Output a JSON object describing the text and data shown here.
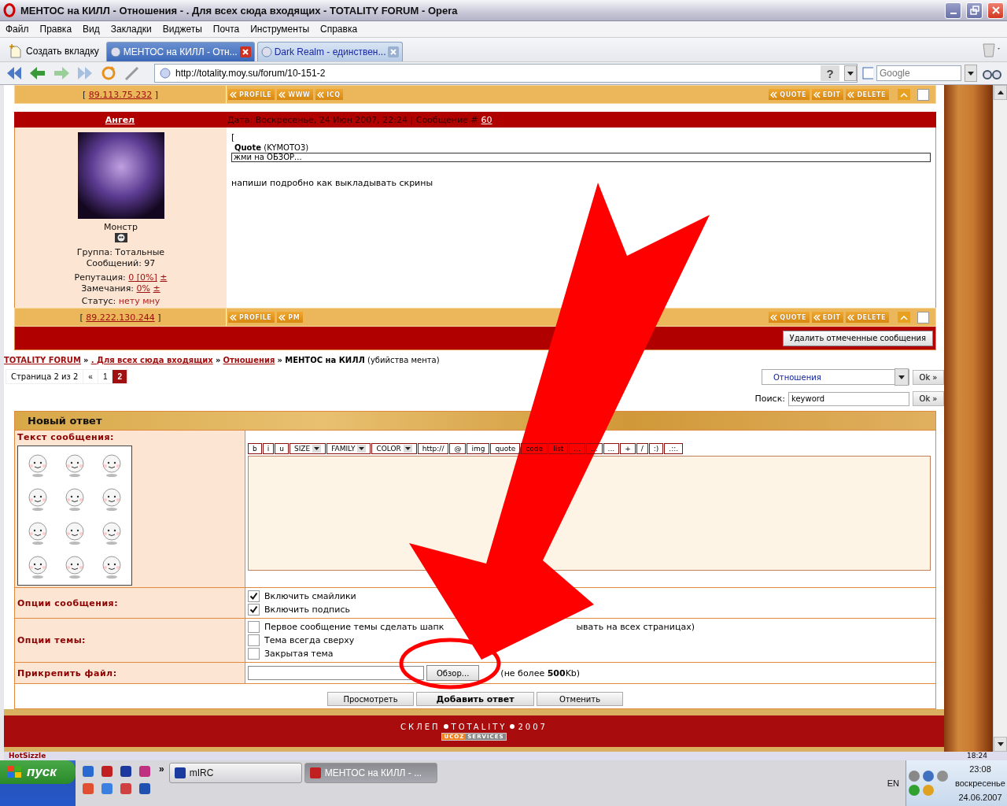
{
  "window": {
    "title": "МЕНТОС на КИЛЛ - Отношения - . Для всех сюда входящих - TOTALITY FORUM - Opera"
  },
  "menu": [
    "Файл",
    "Правка",
    "Вид",
    "Закладки",
    "Виджеты",
    "Почта",
    "Инструменты",
    "Справка"
  ],
  "new_tab": "Создать вкладку",
  "tabs": [
    {
      "label": "МЕНТОС на КИЛЛ - Отн...",
      "selected": true
    },
    {
      "label": "Dark Realm - единствен...",
      "selected": false
    }
  ],
  "address": {
    "url": "http://totality.moy.su/forum/10-151-2",
    "help": "?"
  },
  "web_search": {
    "placeholder": "Google"
  },
  "prev_post_bar": {
    "brackets": [
      "[",
      "]"
    ],
    "ip": "89.113.75.232",
    "left_buttons": [
      "PROFILE",
      "WWW",
      "ICQ"
    ],
    "right_buttons": [
      "QUOTE",
      "EDIT",
      "DELETE"
    ],
    "checked": false
  },
  "post": {
    "author": "Ангел",
    "header": "Дата: Воскресенье, 24 Июн 2007, 22:24 | Сообщение #",
    "number": "60",
    "rank": "Монстр",
    "group": "Группа: Тотальные",
    "messages": "Сообщений: 97",
    "reputation": {
      "label": "Репутация:",
      "value": "0 [0%]",
      "change": "±"
    },
    "remarks": {
      "label": "Замечания:",
      "value": "0%",
      "change": "±"
    },
    "status": {
      "label": "Статус:",
      "value": "нету мну"
    },
    "bracket": "[",
    "quote_title": "**Quote** (KYMOTO3)",
    "quote_text": "жми на ОБЗОР...",
    "message": "напиши подробно как выкладывать скрины",
    "bar": {
      "brackets": [
        "[",
        "]"
      ],
      "ip": "89.222.130.244",
      "left_buttons": [
        "PROFILE",
        "PM"
      ],
      "right_buttons": [
        "QUOTE",
        "EDIT",
        "DELETE"
      ],
      "checked": false
    }
  },
  "delete_selected": "Удалить отмеченные сообщения",
  "breadcrumb": {
    "links": [
      "TOTALITY FORUM",
      ". Для всех сюда входящих",
      "Отношения"
    ],
    "separator": "»",
    "current": "МЕНТОС на КИЛЛ",
    "note": "(убийства мента)"
  },
  "pagination": {
    "label": "Страница 2 из 2",
    "pages": [
      {
        "label": "«",
        "selected": false
      },
      {
        "label": "1",
        "selected": false
      },
      {
        "label": "2",
        "selected": true
      }
    ]
  },
  "forum_jump": {
    "value": "Отношения",
    "button": "Ok »"
  },
  "forum_search": {
    "label": "Поиск:",
    "value": "keyword",
    "button": "Ok »"
  },
  "reply": {
    "title": "Новый ответ",
    "text_label": "Текст сообщения:",
    "toolbar": [
      {
        "label": "b",
        "kind": "button"
      },
      {
        "label": "i",
        "kind": "button"
      },
      {
        "label": "u",
        "kind": "button"
      },
      {
        "label": "SIZE",
        "kind": "select"
      },
      {
        "label": "FAMILY",
        "kind": "select"
      },
      {
        "label": "COLOR",
        "kind": "select"
      },
      {
        "label": "http://",
        "kind": "button"
      },
      {
        "label": "@",
        "kind": "button"
      },
      {
        "label": "img",
        "kind": "button"
      },
      {
        "label": "quote",
        "kind": "button"
      },
      {
        "label": "code",
        "kind": "button"
      },
      {
        "label": "list",
        "kind": "button"
      },
      {
        "label": "...",
        "kind": "button"
      },
      {
        "label": "...",
        "kind": "button"
      },
      {
        "label": "...",
        "kind": "button"
      },
      {
        "label": "+",
        "kind": "button"
      },
      {
        "label": "/",
        "kind": "button"
      },
      {
        "label": ":)",
        "kind": "button"
      },
      {
        "label": ".::.",
        "kind": "button"
      }
    ],
    "message_options_label": "Опции сообщения:",
    "message_options": [
      {
        "label": "Включить смайлики",
        "checked": true
      },
      {
        "label": "Включить подпись",
        "checked": true
      }
    ],
    "topic_options_label": "Опции темы:",
    "topic_options": [
      {
        "label": "Первое сообщение темы сделать шапк",
        "label_continued": "ывать на всех страницах)",
        "checked": false
      },
      {
        "label": "Тема всегда сверху",
        "checked": false
      },
      {
        "label": "Закрытая тема",
        "checked": false
      }
    ],
    "attach_label": "Прикрепить файл:",
    "browse": "Обзор...",
    "limit": "(не более **500**Kb)",
    "buttons": [
      "Просмотреть",
      "Добавить ответ",
      "Отменить"
    ]
  },
  "footer": {
    "words": [
      "СКЛЕП",
      "TOTALITY"
    ],
    "year": "2007",
    "badge": [
      "UCOZ",
      "SERVICES"
    ]
  },
  "panel_strip": {
    "title": "HotSizzle",
    "time": "18:24"
  },
  "taskbar": {
    "start": "пуск",
    "more": "»",
    "tasks": [
      {
        "label": "mIRC",
        "selected": false
      },
      {
        "label": "МЕНТОС на КИЛЛ - ...",
        "selected": true
      }
    ],
    "lang": "EN",
    "time": "23:08",
    "day": "воскресенье",
    "date": "24.06.2007"
  }
}
